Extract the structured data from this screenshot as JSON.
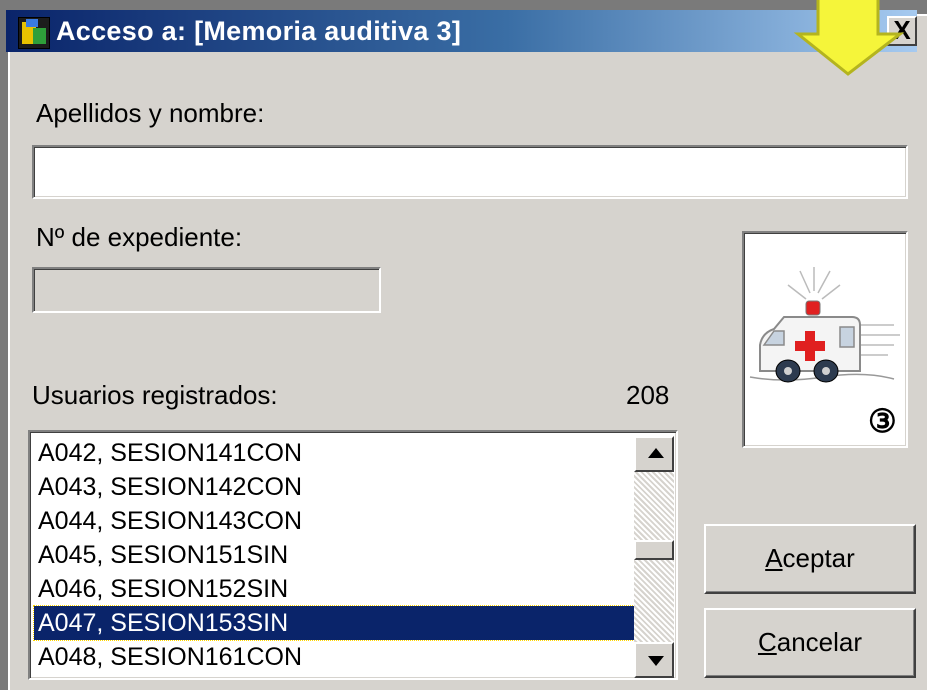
{
  "window": {
    "title": "Acceso a: [Memoria auditiva 3]",
    "close_label": "X"
  },
  "form": {
    "name_label": "Apellidos y nombre:",
    "name_value": "",
    "expediente_label": "Nº de expediente:",
    "expediente_value": ""
  },
  "users": {
    "label": "Usuarios registrados:",
    "count": "208",
    "items": [
      "A042, SESION141CON",
      "A043, SESION142CON",
      "A044, SESION143CON",
      "A045, SESION151SIN",
      "A046, SESION152SIN",
      "A047, SESION153SIN",
      "A048, SESION161CON"
    ],
    "selected_index": 5
  },
  "picture": {
    "icon": "ambulance-icon",
    "badge": "③"
  },
  "buttons": {
    "accept_mnemonic": "A",
    "accept_rest": "ceptar",
    "cancel_mnemonic": "C",
    "cancel_rest": "ancelar"
  },
  "colors": {
    "title_start": "#0a246a",
    "title_end": "#a6caf0",
    "selection": "#0a246a",
    "face": "#d6d3ce",
    "arrow": "#f5f53a"
  }
}
